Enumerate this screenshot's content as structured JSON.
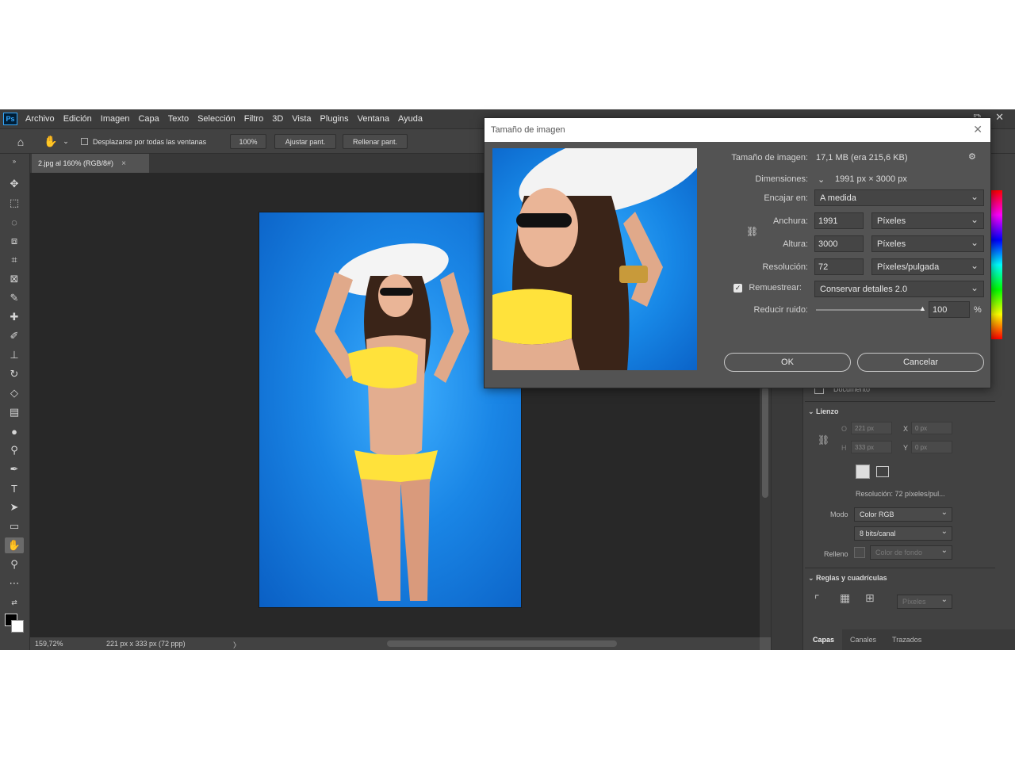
{
  "menubar": {
    "logo": "Ps",
    "items": [
      "Archivo",
      "Edición",
      "Imagen",
      "Capa",
      "Texto",
      "Selección",
      "Filtro",
      "3D",
      "Vista",
      "Plugins",
      "Ventana",
      "Ayuda"
    ]
  },
  "options": {
    "scroll_all_label": "Desplazarse por todas las ventanas",
    "zoom_btn": "100%",
    "fit_btn": "Ajustar pant.",
    "fill_btn": "Rellenar pant."
  },
  "document": {
    "tab_title": "2.jpg al 160% (RGB/8#)",
    "close_glyph": "×"
  },
  "status": {
    "zoom": "159,72%",
    "doc_info": "221 px x 333 px (72 ppp)",
    "arrow": "〉"
  },
  "dialog": {
    "title": "Tamaño de imagen",
    "image_size_label": "Tamaño de imagen:",
    "image_size_value": "17,1 MB (era 215,6 KB)",
    "dimensions_label": "Dimensiones:",
    "dimensions_value": "1991 px × 3000 px",
    "fit_label": "Encajar en:",
    "fit_value": "A medida",
    "width_label": "Anchura:",
    "width_value": "1991",
    "width_unit": "Píxeles",
    "height_label": "Altura:",
    "height_value": "3000",
    "height_unit": "Píxeles",
    "resolution_label": "Resolución:",
    "resolution_value": "72",
    "resolution_unit": "Píxeles/pulgada",
    "resample_label": "Remuestrear:",
    "resample_value": "Conservar detalles 2.0",
    "noise_label": "Reducir ruido:",
    "noise_value": "100",
    "noise_unit": "%",
    "noise_level": 1.0,
    "ok": "OK",
    "cancel": "Cancelar"
  },
  "panel": {
    "documento": "Documento",
    "lienzo": "Lienzo",
    "w_label": "O",
    "w_value": "221 px",
    "h_label": "H",
    "h_value": "333 px",
    "x_label": "X",
    "x_value": "0 px",
    "y_label": "Y",
    "y_value": "0 px",
    "resolution": "Resolución: 72 píxeles/pul...",
    "mode_label": "Modo",
    "mode_value": "Color RGB",
    "bits_value": "8 bits/canal",
    "fill_label": "Relleno",
    "fill_value": "Color de fondo",
    "rulers_title": "Reglas y cuadrículas",
    "rulers_unit": "Píxeles",
    "tabs": [
      "Capas",
      "Canales",
      "Trazados"
    ]
  },
  "colors": {
    "ui_dark": "#424242",
    "canvas_bg": "#282828",
    "accent_blue": "#31a8ff"
  }
}
